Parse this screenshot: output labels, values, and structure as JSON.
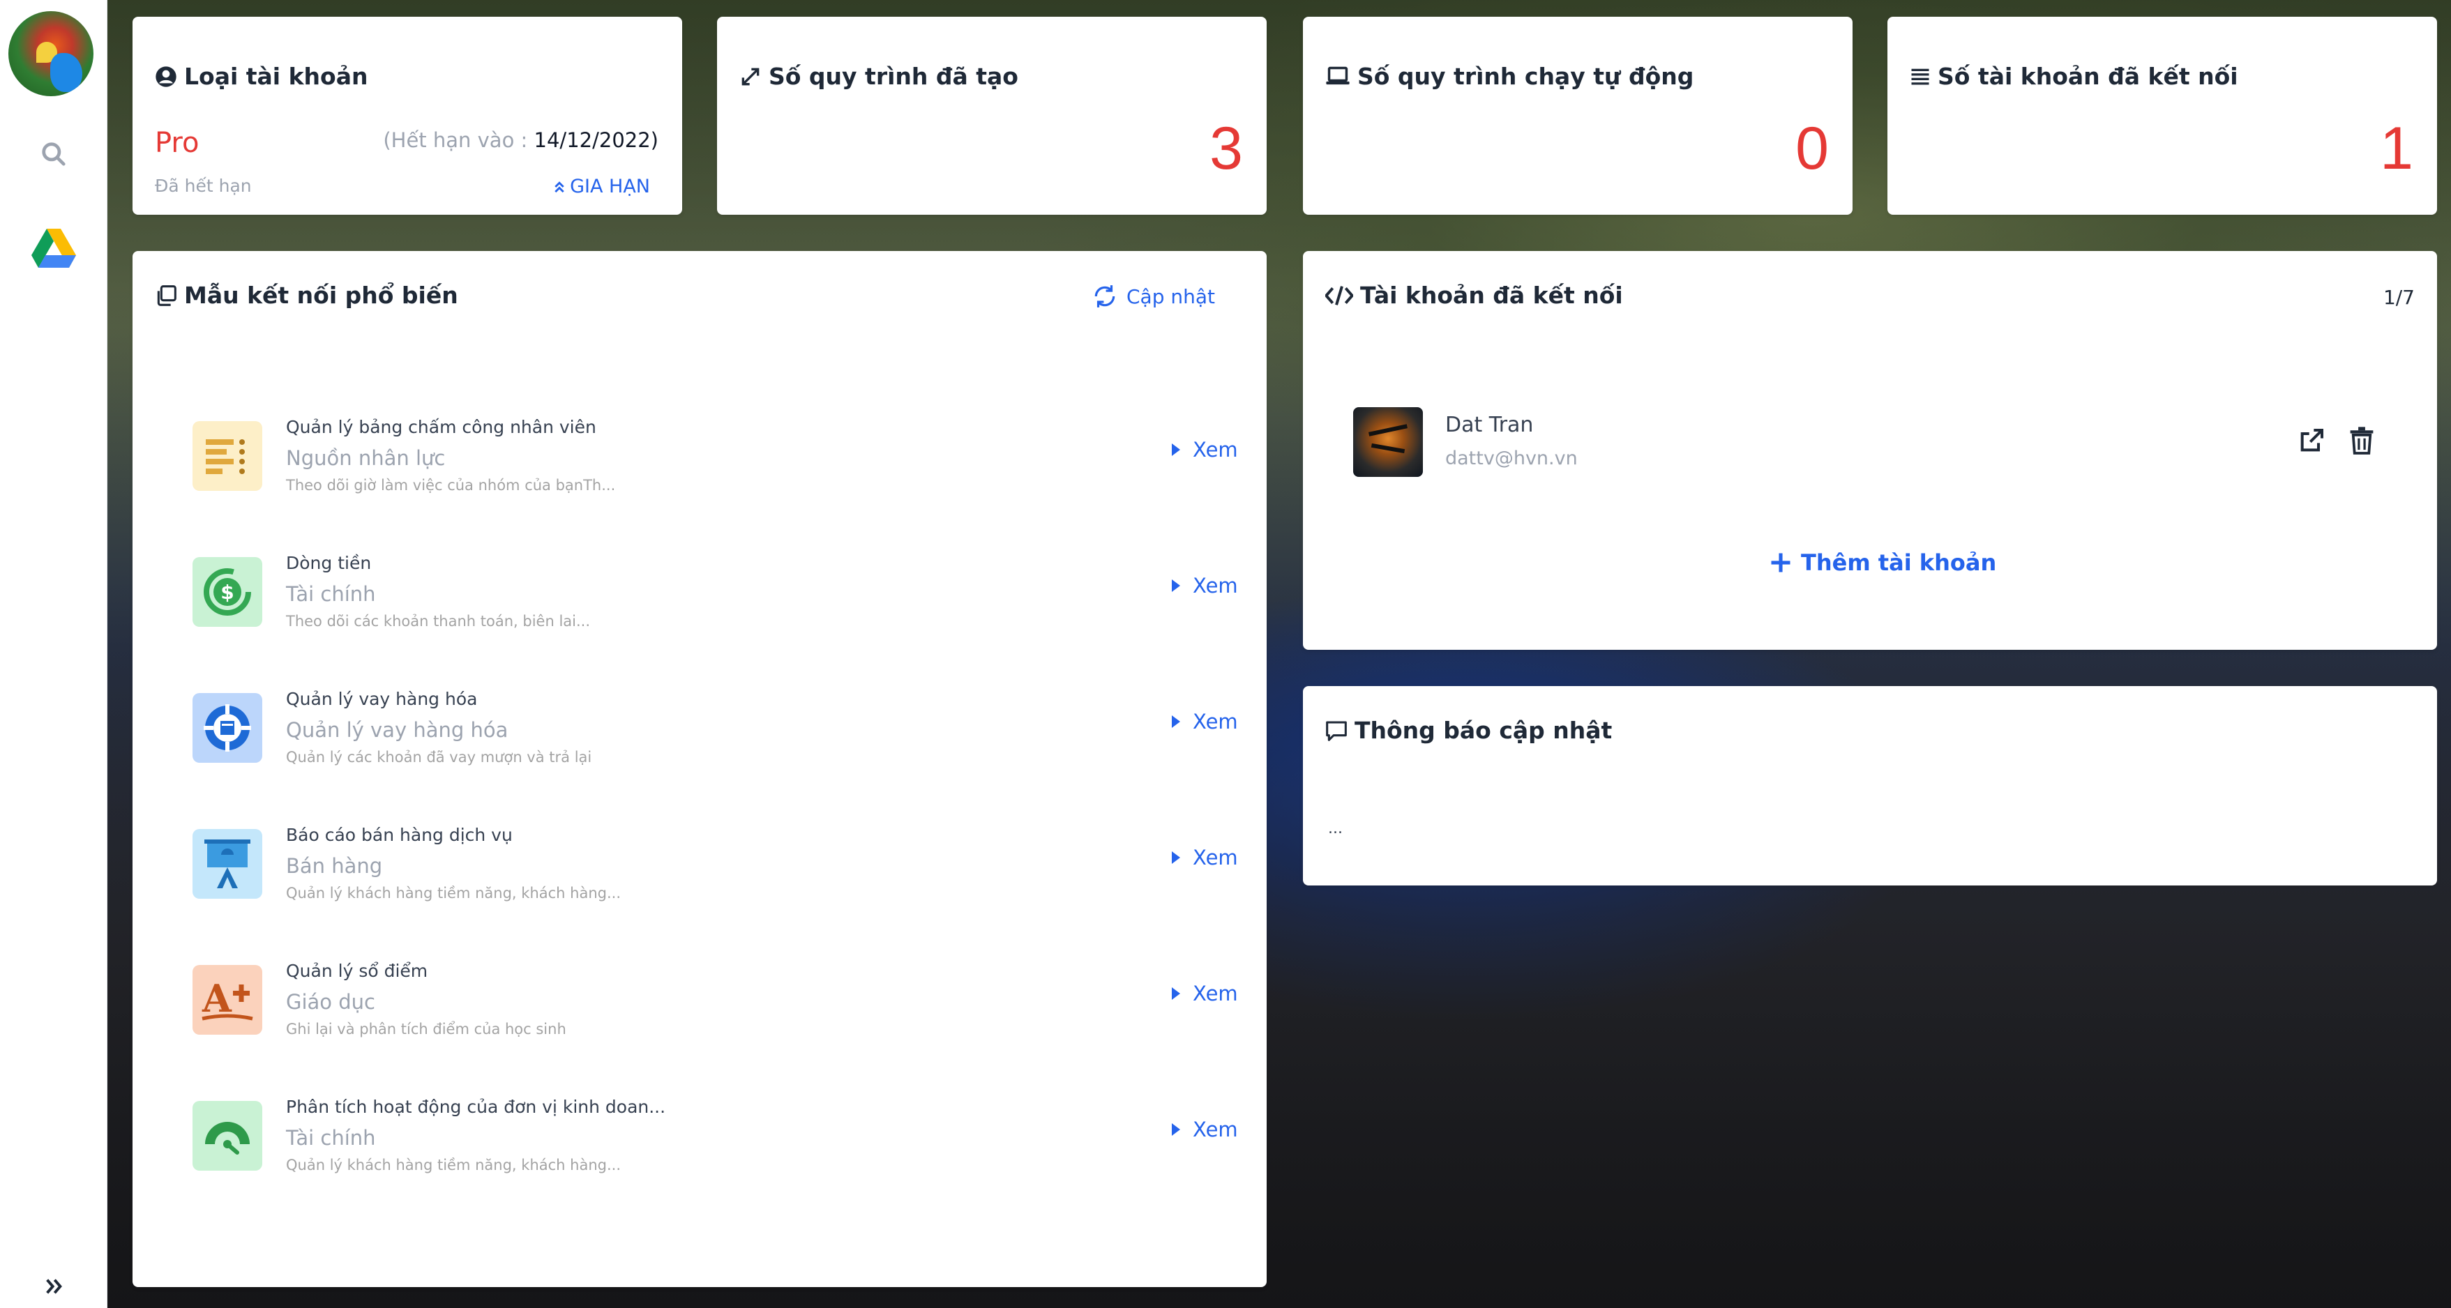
{
  "sidebar": {
    "avatar_alt": "user avatar",
    "icons": [
      "search-icon",
      "google-drive-icon",
      "expand-icon"
    ]
  },
  "stats": {
    "account_type": {
      "title": "Loại tài khoản",
      "plan": "Pro",
      "expiry_label": "(Hết hạn vào :",
      "expiry_date": "14/12/2022)",
      "status": "Đã hết hạn",
      "renew_label": "GIA HẠN"
    },
    "workflows_created": {
      "title": "Số quy trình đã tạo",
      "value": "3"
    },
    "workflows_auto": {
      "title": "Số quy trình chạy tự động",
      "value": "0"
    },
    "accounts_connected": {
      "title": "Số tài khoản đã kết nối",
      "value": "1"
    }
  },
  "templates": {
    "title": "Mẫu kết nối phổ biến",
    "refresh_label": "Cập nhật",
    "view_label": "Xem",
    "items": [
      {
        "name": "Quản lý bảng chấm công nhân viên",
        "category": "Nguồn nhân lực",
        "description": "Theo dõi giờ làm việc của nhóm của bạnTh...",
        "icon": "timesheet-icon",
        "color": "#fdefc8"
      },
      {
        "name": "Dòng tiền",
        "category": "Tài chính",
        "description": "Theo dõi các khoản thanh toán, biên lai...",
        "icon": "cashflow-icon",
        "color": "#c9f2d4"
      },
      {
        "name": "Quản lý vay hàng hóa",
        "category": "Quản lý vay hàng hóa",
        "description": "Quản lý các khoản đã vay mượn và trả lại",
        "icon": "loan-icon",
        "color": "#bcd6fb"
      },
      {
        "name": "Báo cáo bán hàng dịch vụ",
        "category": "Bán hàng",
        "description": "Quản lý khách hàng tiềm năng, khách hàng...",
        "icon": "sales-report-icon",
        "color": "#c4e7fb"
      },
      {
        "name": "Quản lý sổ điểm",
        "category": "Giáo dục",
        "description": "Ghi lại và phân tích điểm của học sinh",
        "icon": "grade-icon",
        "color": "#fbd2bc"
      },
      {
        "name": "Phân tích hoạt động của đơn vị kinh doan...",
        "category": "Tài chính",
        "description": "Quản lý khách hàng tiềm năng, khách hàng...",
        "icon": "gauge-icon",
        "color": "#c9f2d4"
      }
    ]
  },
  "connected": {
    "title": "Tài khoản đã kết nối",
    "pager": "1/7",
    "account": {
      "name": "Dat Tran",
      "email": "dattv@hvn.vn"
    },
    "add_label": "Thêm tài khoản"
  },
  "updates": {
    "title": "Thông báo cập nhật",
    "body": "..."
  },
  "colors": {
    "accent": "#2563eb",
    "danger": "#e53935"
  }
}
